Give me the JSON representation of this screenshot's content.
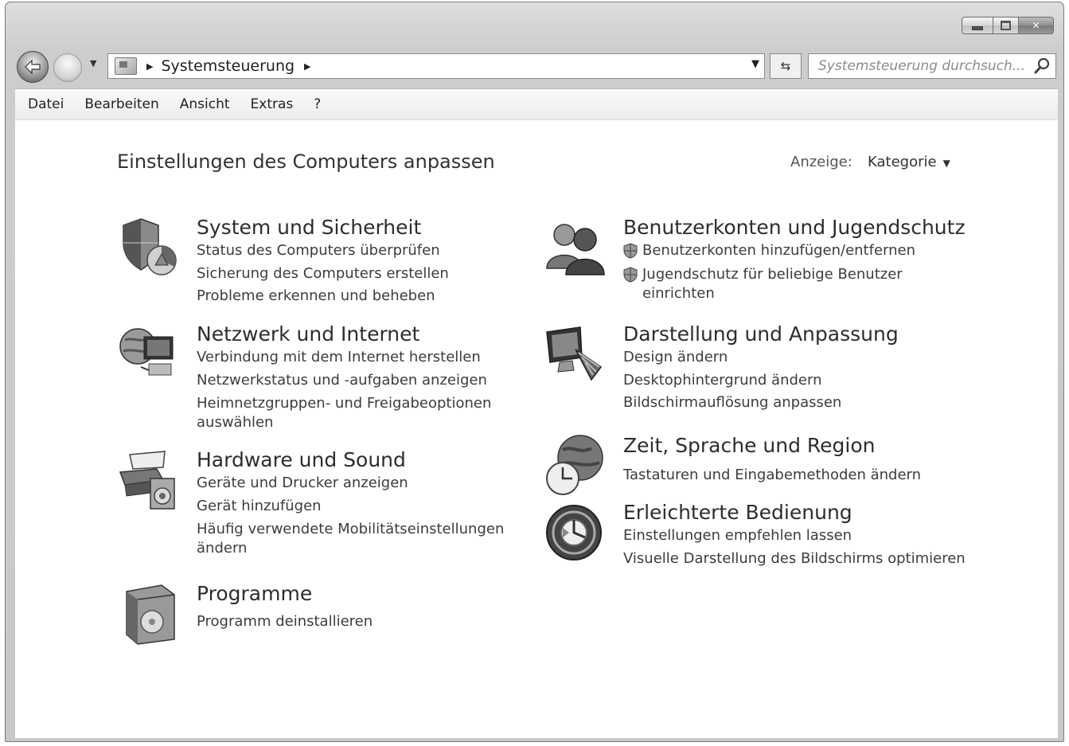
{
  "window": {
    "address": {
      "crumb": "Systemsteuerung"
    },
    "search": {
      "placeholder": "Systemsteuerung durchsuch..."
    }
  },
  "menu": [
    {
      "label": "Datei"
    },
    {
      "label": "Bearbeiten"
    },
    {
      "label": "Ansicht"
    },
    {
      "label": "Extras"
    },
    {
      "label": "?"
    }
  ],
  "content": {
    "title": "Einstellungen des Computers anpassen",
    "view_label": "Anzeige:",
    "view_value": "Kategorie"
  },
  "categories": [
    {
      "title": "System und Sicherheit",
      "icon": "shield-pie-icon",
      "links": [
        "Status des Computers überprüfen",
        "Sicherung des Computers erstellen",
        "Probleme erkennen und beheben"
      ]
    },
    {
      "title": "Netzwerk und Internet",
      "icon": "network-globe-icon",
      "links": [
        "Verbindung mit dem Internet herstellen",
        "Netzwerkstatus und -aufgaben anzeigen",
        "Heimnetzgruppen- und Freigabeoptionen auswählen"
      ]
    },
    {
      "title": "Hardware und Sound",
      "icon": "printer-speaker-icon",
      "links": [
        "Geräte und Drucker anzeigen",
        "Gerät hinzufügen",
        "Häufig verwendete Mobilitätseinstellungen ändern"
      ]
    },
    {
      "title": "Programme",
      "icon": "programs-box-icon",
      "links": [
        "Programm deinstallieren"
      ]
    },
    {
      "title": "Benutzerkonten und Jugendschutz",
      "icon": "users-icon",
      "links": [
        "Benutzerkonten hinzufügen/entfernen",
        "Jugendschutz für beliebige Benutzer einrichten"
      ]
    },
    {
      "title": "Darstellung und Anpassung",
      "icon": "monitor-palette-icon",
      "links": [
        "Design ändern",
        "Desktophintergrund ändern",
        "Bildschirmauflösung anpassen"
      ]
    },
    {
      "title": "Zeit, Sprache und Region",
      "icon": "globe-clock-icon",
      "links": [
        "Tastaturen und Eingabemethoden ändern"
      ]
    },
    {
      "title": "Erleichterte Bedienung",
      "icon": "accessibility-icon",
      "links": [
        "Einstellungen empfehlen lassen",
        "Visuelle Darstellung des Bildschirms optimieren"
      ]
    }
  ]
}
